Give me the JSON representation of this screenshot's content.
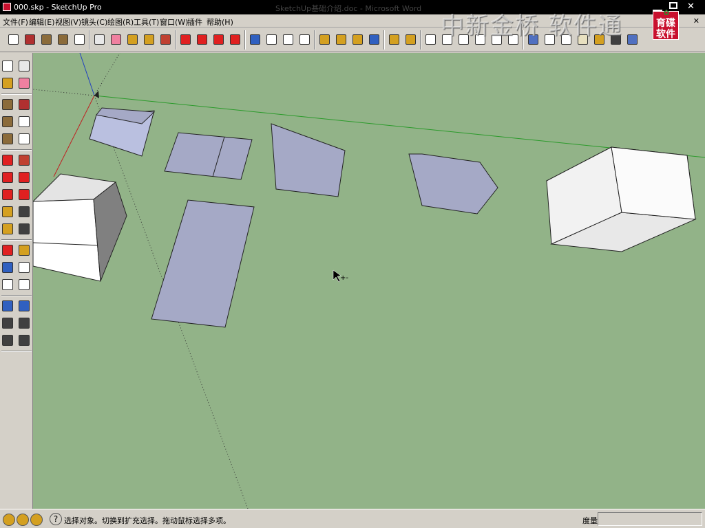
{
  "window": {
    "title": "000.skp - SketchUp Pro",
    "background_title": "SketchUp基础介绍.doc - Microsoft Word"
  },
  "menu": [
    {
      "label": "文件(F)"
    },
    {
      "label": "编辑(E)"
    },
    {
      "label": "视图(V)"
    },
    {
      "label": "镜头(C)"
    },
    {
      "label": "绘图(R)"
    },
    {
      "label": "工具(T)"
    },
    {
      "label": "窗口(W)"
    },
    {
      "label": "插件"
    },
    {
      "label": "帮助(H)"
    }
  ],
  "watermark": {
    "text": "中新金桥 软件通",
    "logo_text": "育碟软件"
  },
  "toolbar": [
    {
      "icon": "select-icon",
      "color": "#ffffff"
    },
    {
      "icon": "pencil-icon",
      "color": "#b03030"
    },
    {
      "icon": "rectangle-icon",
      "color": "#8b6b3a"
    },
    {
      "icon": "circle-icon",
      "color": "#8b6b3a"
    },
    {
      "icon": "arc-icon",
      "color": "#ffffff"
    },
    {
      "icon": "make-component-icon",
      "color": "#e8e8e8"
    },
    {
      "icon": "eraser-icon",
      "color": "#f080a0"
    },
    {
      "icon": "tape-measure-icon",
      "color": "#d4a020"
    },
    {
      "icon": "paint-bucket-icon",
      "color": "#d4a020"
    },
    {
      "icon": "push-pull-icon",
      "color": "#c04030"
    },
    {
      "icon": "move-icon",
      "color": "#e02020"
    },
    {
      "icon": "rotate-icon",
      "color": "#e02020"
    },
    {
      "icon": "follow-me-icon",
      "color": "#e02020"
    },
    {
      "icon": "offset-icon",
      "color": "#e02020"
    },
    {
      "icon": "orbit-icon",
      "color": "#3060c0"
    },
    {
      "icon": "pan-icon",
      "color": "#ffffff"
    },
    {
      "icon": "zoom-icon",
      "color": "#ffffff"
    },
    {
      "icon": "zoom-extents-icon",
      "color": "#ffffff"
    },
    {
      "icon": "add-location-icon",
      "color": "#d4a020"
    },
    {
      "icon": "get-models-icon",
      "color": "#d4a020"
    },
    {
      "icon": "share-model-icon",
      "color": "#d4a020"
    },
    {
      "icon": "google-earth-icon",
      "color": "#3060c0"
    },
    {
      "icon": "get-components-icon",
      "color": "#d4a020"
    },
    {
      "icon": "share-component-icon",
      "color": "#d4a020"
    },
    {
      "icon": "iso-view-icon",
      "color": "#ffffff"
    },
    {
      "icon": "top-view-icon",
      "color": "#ffffff"
    },
    {
      "icon": "front-view-icon",
      "color": "#ffffff"
    },
    {
      "icon": "right-view-icon",
      "color": "#ffffff"
    },
    {
      "icon": "back-view-icon",
      "color": "#ffffff"
    },
    {
      "icon": "left-view-icon",
      "color": "#ffffff"
    },
    {
      "icon": "xray-icon",
      "color": "#5070c0"
    },
    {
      "icon": "wireframe-icon",
      "color": "#ffffff"
    },
    {
      "icon": "hidden-line-icon",
      "color": "#ffffff"
    },
    {
      "icon": "shaded-icon",
      "color": "#e8e0c0"
    },
    {
      "icon": "shaded-textures-icon",
      "color": "#d4a020"
    },
    {
      "icon": "monochrome-icon",
      "color": "#404040"
    },
    {
      "icon": "display-mode-icon",
      "color": "#5070c0"
    }
  ],
  "left_toolbar": [
    {
      "icon": "select-icon",
      "color": "#ffffff"
    },
    {
      "icon": "make-component-icon",
      "color": "#e8e8e8"
    },
    {
      "icon": "paint-bucket-icon",
      "color": "#d4a020"
    },
    {
      "icon": "eraser-icon",
      "color": "#f080a0"
    },
    {
      "icon": "rectangle-icon",
      "color": "#8b6b3a"
    },
    {
      "icon": "line-icon",
      "color": "#b03030"
    },
    {
      "icon": "circle-icon",
      "color": "#8b6b3a"
    },
    {
      "icon": "arc-icon",
      "color": "#ffffff"
    },
    {
      "icon": "polygon-icon",
      "color": "#8b6b3a"
    },
    {
      "icon": "freehand-icon",
      "color": "#ffffff"
    },
    {
      "icon": "move-icon",
      "color": "#e02020"
    },
    {
      "icon": "push-pull-icon",
      "color": "#c04030"
    },
    {
      "icon": "rotate-icon",
      "color": "#e02020"
    },
    {
      "icon": "follow-me-icon",
      "color": "#e02020"
    },
    {
      "icon": "scale-icon",
      "color": "#e02020"
    },
    {
      "icon": "offset-icon",
      "color": "#e02020"
    },
    {
      "icon": "tape-measure-icon",
      "color": "#d4a020"
    },
    {
      "icon": "dimension-icon",
      "color": "#404040"
    },
    {
      "icon": "protractor-icon",
      "color": "#d4a020"
    },
    {
      "icon": "text-icon",
      "color": "#404040"
    },
    {
      "icon": "axes-icon",
      "color": "#e02020"
    },
    {
      "icon": "3d-text-icon",
      "color": "#d4a020"
    },
    {
      "icon": "orbit-icon",
      "color": "#3060c0"
    },
    {
      "icon": "pan-icon",
      "color": "#ffffff"
    },
    {
      "icon": "zoom-icon",
      "color": "#ffffff"
    },
    {
      "icon": "zoom-window-icon",
      "color": "#ffffff"
    },
    {
      "icon": "zoom-extents-icon",
      "color": "#3060c0"
    },
    {
      "icon": "previous-view-icon",
      "color": "#3060c0"
    },
    {
      "icon": "position-camera-icon",
      "color": "#404040"
    },
    {
      "icon": "look-around-icon",
      "color": "#404040"
    },
    {
      "icon": "walk-icon",
      "color": "#404040"
    },
    {
      "icon": "section-plane-icon",
      "color": "#404040"
    }
  ],
  "viewport": {
    "background": "#92b388"
  },
  "status": {
    "message": "选择对象。切换到扩充选择。拖动鼠标选择多项。",
    "measure_label": "度量",
    "measure_value": ""
  }
}
